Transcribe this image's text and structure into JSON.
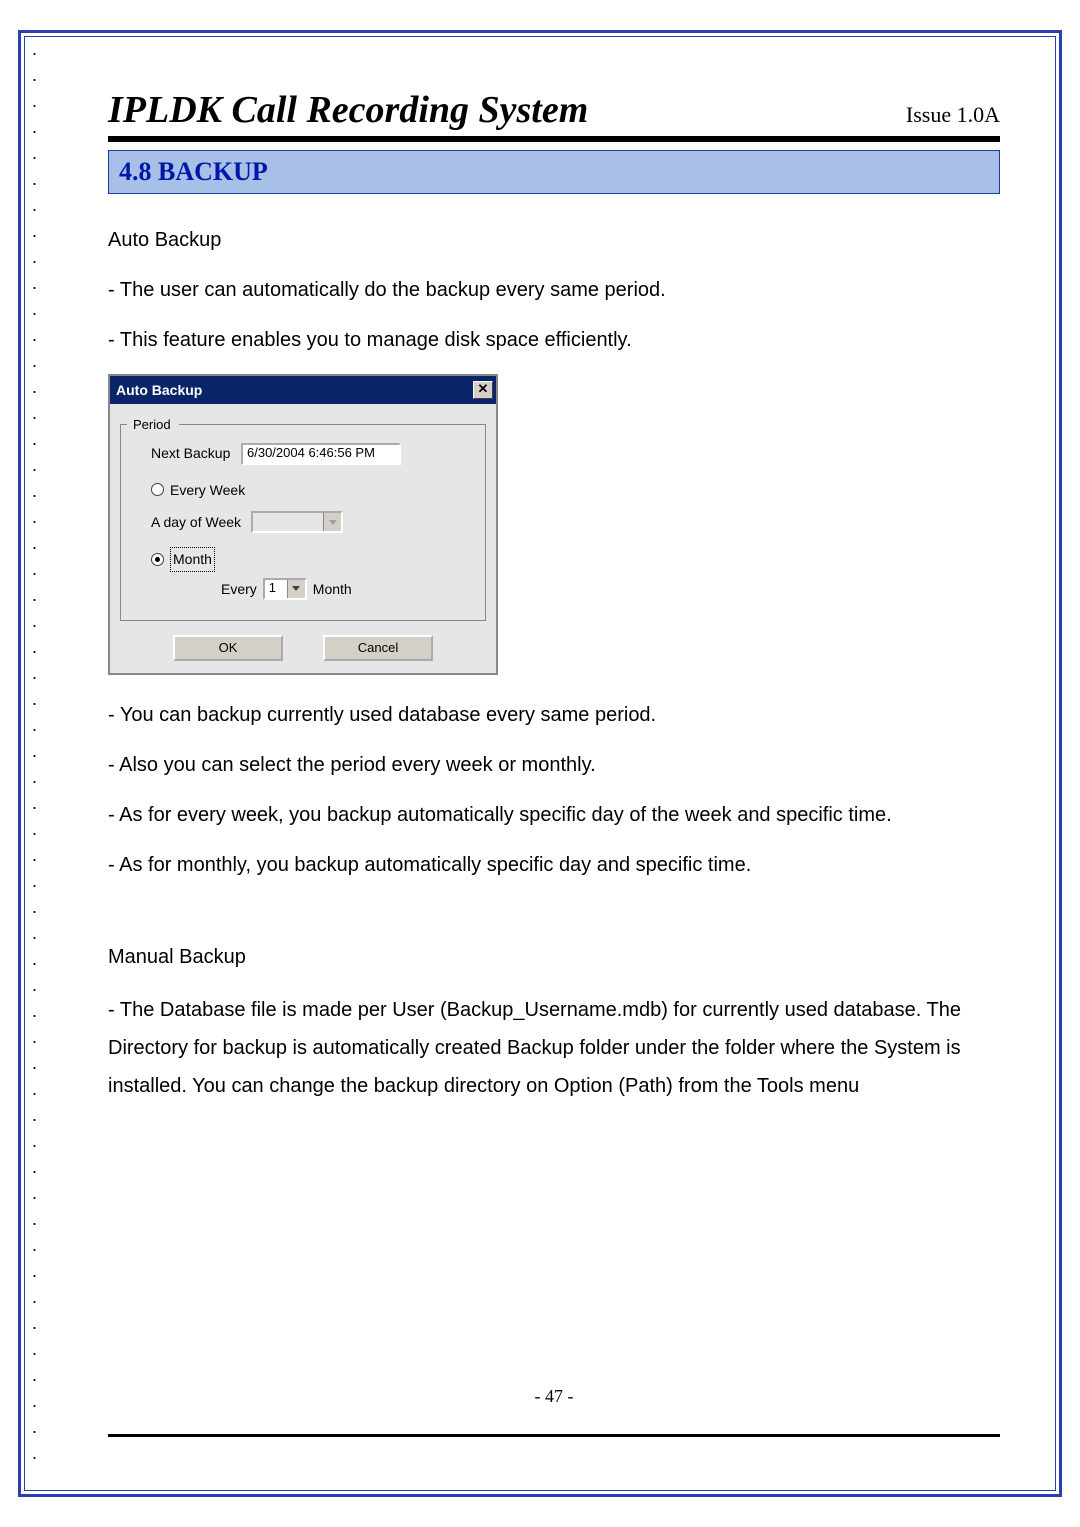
{
  "document": {
    "title": "IPLDK Call Recording System",
    "issue": "Issue 1.0A",
    "section_number_title": "4.8 BACKUP",
    "page_number": "- 47 -"
  },
  "body": {
    "sub1": "Auto Backup",
    "b1": "- The user can automatically do the backup every same period.",
    "b2": "- This feature enables you to manage disk space efficiently.",
    "b3": "- You can backup currently used database every same period.",
    "b4": "- Also you can select the period every week or monthly.",
    "b5": "- As for every week, you backup automatically specific day of the week and specific time.",
    "b6": "- As for monthly, you backup automatically specific day and specific time.",
    "sub2": "Manual Backup",
    "b7": "- The Database file is made per User (Backup_Username.mdb) for currently used database. The Directory for backup is automatically created Backup folder under the folder where the System is installed. You can change the backup directory on Option (Path) from the Tools menu"
  },
  "dialog": {
    "title": "Auto Backup",
    "close_glyph": "✕",
    "legend": "Period",
    "next_backup_label": "Next Backup",
    "next_backup_value": "6/30/2004 6:46:56 PM",
    "radio_week": "Every Week",
    "day_of_week_label": "A day of Week",
    "day_of_week_value": "",
    "radio_month": "Month",
    "every_label": "Every",
    "every_value": "1",
    "month_unit": "Month",
    "ok": "OK",
    "cancel": "Cancel",
    "selected_radio": "month"
  }
}
